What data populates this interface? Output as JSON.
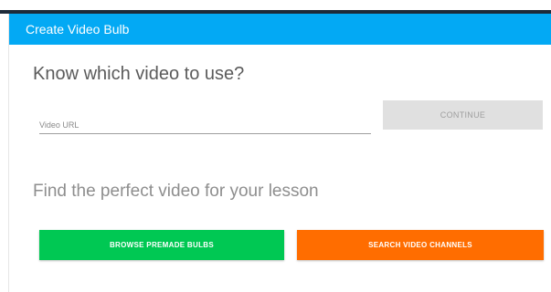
{
  "dialog": {
    "title": "Create Video Bulb",
    "header_color": "#03a9f4"
  },
  "known_video": {
    "heading": "Know which video to use?",
    "url_field": {
      "placeholder": "Video URL",
      "value": ""
    },
    "continue_label": "CONTINUE",
    "continue_state": "disabled"
  },
  "find_video": {
    "heading": "Find the perfect video for your lesson",
    "browse_label": "BROWSE PREMADE BULBS",
    "browse_color": "#00c853",
    "search_label": "SEARCH VIDEO CHANNELS",
    "search_color": "#ff6d00"
  }
}
